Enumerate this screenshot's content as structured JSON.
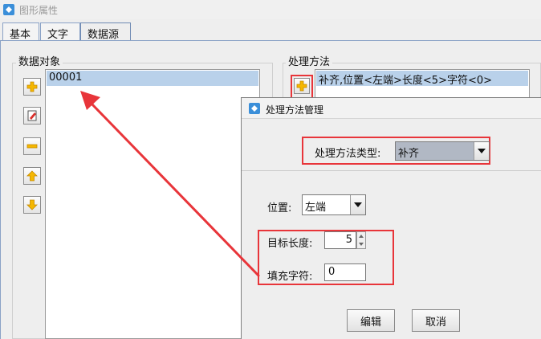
{
  "window": {
    "title": "图形属性"
  },
  "tabs": [
    {
      "label": "基本",
      "active": false
    },
    {
      "label": "文字",
      "active": false
    },
    {
      "label": "数据源",
      "active": true
    }
  ],
  "data_objects": {
    "label": "数据对象",
    "items": [
      "00001"
    ],
    "buttons": [
      "add-icon",
      "edit-icon",
      "remove-icon",
      "move-up-icon",
      "move-down-icon"
    ]
  },
  "processing": {
    "label": "处理方法",
    "items": [
      "补齐,位置<左端>长度<5>字符<0>"
    ],
    "add_button_icon": "add-icon"
  },
  "dialog": {
    "title": "处理方法管理",
    "type_label": "处理方法类型:",
    "type_value": "补齐",
    "position_label": "位置:",
    "position_value": "左端",
    "length_label": "目标长度:",
    "length_value": "5",
    "fill_label": "填充字符:",
    "fill_value": "0",
    "edit_button": "编辑",
    "cancel_button": "取消"
  },
  "colors": {
    "highlight": "#e8353a",
    "selection": "#b9d1ea",
    "accent": "#f5a623"
  }
}
